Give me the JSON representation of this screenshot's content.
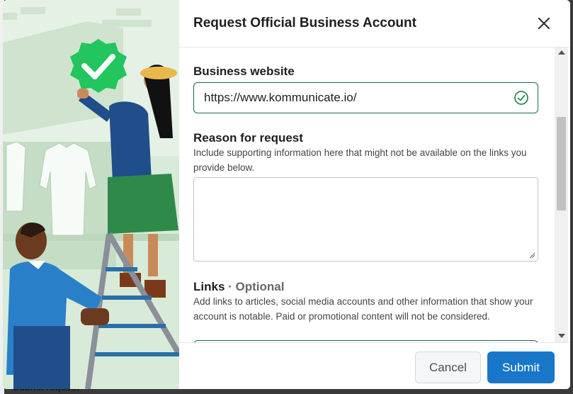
{
  "backdrop": {
    "partial_text": "Submit request"
  },
  "dialog": {
    "title": "Request Official Business Account",
    "business_website": {
      "label": "Business website",
      "value": "https://www.kommunicate.io/",
      "status_icon": "check-circle-icon"
    },
    "reason": {
      "label": "Reason for request",
      "help": "Include supporting information here that might not be available on the links you provide below.",
      "value": ""
    },
    "links": {
      "label": "Links",
      "optional": "· Optional",
      "help": "Add links to articles, social media accounts and other information that show your account is notable. Paid or promotional content will not be considered."
    },
    "buttons": {
      "cancel": "Cancel",
      "submit": "Submit"
    }
  },
  "colors": {
    "accent": "#1877c9",
    "verified_badge": "#22c55e",
    "field_border_valid": "#1c6b4a",
    "illustration_bg": "#eaf4ea"
  }
}
